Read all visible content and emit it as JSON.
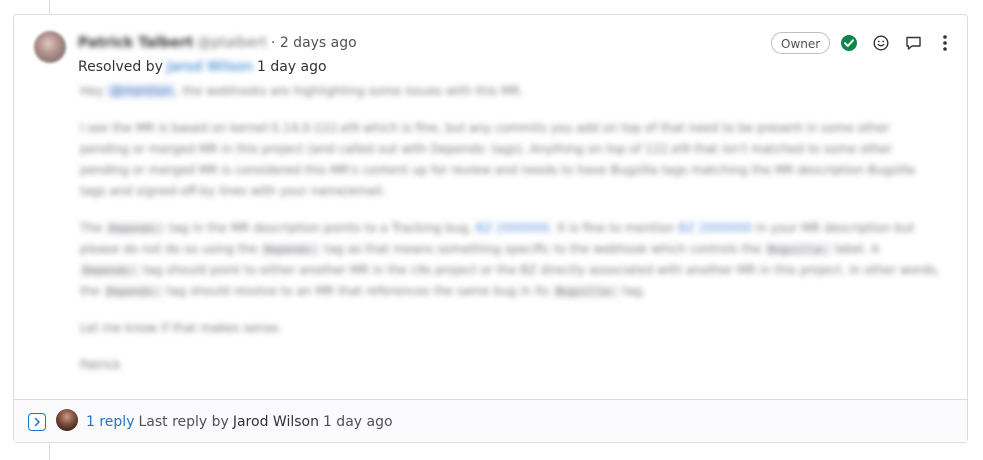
{
  "note": {
    "author_name": "Patrick Talbert",
    "author_handle": "@ptalbert",
    "time_ago": "· 2 days ago",
    "resolved_prefix": "Resolved by",
    "resolved_by": "Jarod Wilson",
    "resolved_time": "1 day ago",
    "owner_badge": "Owner",
    "body": {
      "p1_start": "Hey",
      "p1_mention": "@mention",
      "p1_end": ", the webhooks are highlighting some issues with this MR.",
      "p2": "I see the MR is based on kernel-5.14.0-122.el9 which is fine, but any commits you add on top of that need to be present in some other pending or merged MR in this project (and called out with Depends: tags). Anything on top of 122.el9 that isn't matched to some other pending or merged MR is considered this MR's content up for review and needs to have Bugzilla tags matching the MR description Bugzilla tags and signed-off-by lines with your name/email.",
      "p3_a": "The",
      "p3_code1": "Depends:",
      "p3_b": "tag in the MR description points to a Tracking bug,",
      "p3_link1": "BZ 2000000",
      "p3_c": ". It is fine to mention",
      "p3_link2": "BZ 2000000",
      "p3_d": "in your MR description but please do not do so using the",
      "p3_code2": "Depends:",
      "p3_e": "tag as that means something specific to the webhook which controls the",
      "p3_code3": "Bugzilla:",
      "p3_f": "label. A",
      "p3_code4": "Depends:",
      "p3_g": "tag should point to either another MR in the c9s project or the BZ directly associated with another MR in this project. In other words, the",
      "p3_code5": "Depends:",
      "p3_h": "tag should resolve to an MR that references the same bug in its",
      "p3_code6": "Bugzilla:",
      "p3_i": "tag.",
      "p4": "Let me know if that makes sense.",
      "p5": "Patrick"
    }
  },
  "actions": {
    "resolve_icon": "check-circle-icon",
    "emoji_icon": "smiley-icon",
    "comment_icon": "comment-icon",
    "more_icon": "kebab-icon"
  },
  "replies": {
    "count_label": "1 reply",
    "last_reply_prefix": "Last reply by",
    "last_reply_author": "Jarod Wilson",
    "last_reply_time": "1 day ago"
  },
  "colors": {
    "link": "#1f75cb",
    "resolved_green": "#108548",
    "border": "#dcdcde"
  }
}
